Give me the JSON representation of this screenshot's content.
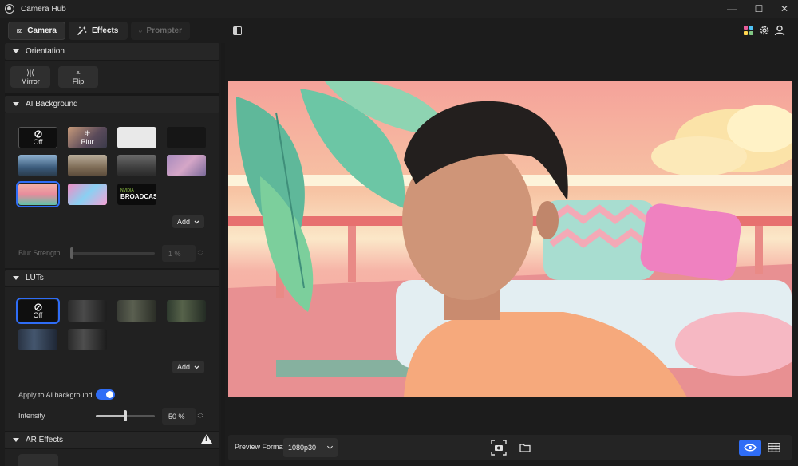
{
  "app": {
    "title": "Camera Hub"
  },
  "window": {
    "minimize": "—",
    "maximize": "☐",
    "close": "✕"
  },
  "tabs": [
    {
      "label": "Camera",
      "icon": "camera-icon",
      "state": "active"
    },
    {
      "label": "Effects",
      "icon": "magic-wand-icon",
      "state": "normal"
    },
    {
      "label": "Prompter",
      "icon": "prompter-icon",
      "state": "disabled"
    }
  ],
  "orientation": {
    "title": "Orientation",
    "mirror_label": "Mirror",
    "flip_label": "Flip"
  },
  "ai_background": {
    "title": "AI Background",
    "off_label": "Off",
    "blur_label": "Blur",
    "broadcast_label_small": "NVIDIA",
    "broadcast_label": "BROADCAST",
    "add_label": "Add",
    "blur_strength_label": "Blur Strength",
    "blur_strength_value": "1 %",
    "blur_strength_fraction": 0.01
  },
  "luts": {
    "title": "LUTs",
    "off_label": "Off",
    "add_label": "Add",
    "apply_label": "Apply to AI background",
    "apply_enabled": true,
    "intensity_label": "Intensity",
    "intensity_value": "50 %",
    "intensity_fraction": 0.5
  },
  "ar_effects": {
    "title": "AR Effects"
  },
  "preview": {
    "format_label": "Preview Format",
    "format_value": "1080p30"
  },
  "colors": {
    "accent": "#2f6df6",
    "panel": "#212121",
    "header": "#262626"
  }
}
